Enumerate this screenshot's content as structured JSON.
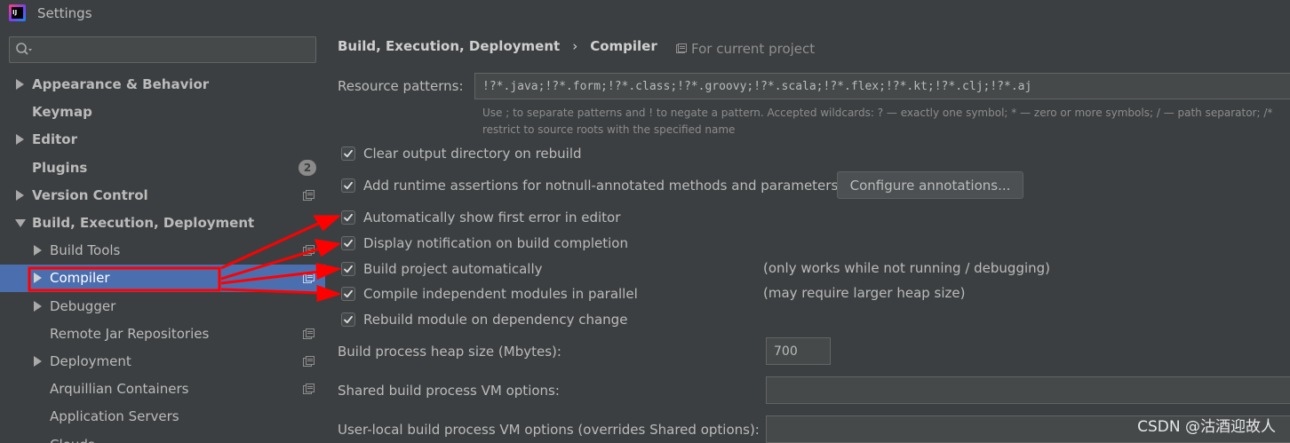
{
  "window": {
    "title": "Settings",
    "logo_text": "IJ"
  },
  "sidebar": {
    "search": {
      "value": "",
      "placeholder": ""
    },
    "items": [
      {
        "label": "Appearance & Behavior",
        "bold": true,
        "expander": "right",
        "level": 0
      },
      {
        "label": "Keymap",
        "bold": true,
        "expander": "none",
        "level": 0
      },
      {
        "label": "Editor",
        "bold": true,
        "expander": "right",
        "level": 0
      },
      {
        "label": "Plugins",
        "bold": true,
        "expander": "none",
        "level": 0,
        "badge": "2"
      },
      {
        "label": "Version Control",
        "bold": true,
        "expander": "right",
        "level": 0,
        "project_icon": true
      },
      {
        "label": "Build, Execution, Deployment",
        "bold": true,
        "expander": "down",
        "level": 0
      },
      {
        "label": "Build Tools",
        "bold": false,
        "expander": "right",
        "level": 1,
        "project_icon": true
      },
      {
        "label": "Compiler",
        "bold": false,
        "expander": "right",
        "level": 1,
        "project_icon": true,
        "selected": true
      },
      {
        "label": "Debugger",
        "bold": false,
        "expander": "right",
        "level": 1
      },
      {
        "label": "Remote Jar Repositories",
        "bold": false,
        "expander": "none",
        "level": 1,
        "project_icon": true
      },
      {
        "label": "Deployment",
        "bold": false,
        "expander": "right",
        "level": 1,
        "project_icon": true
      },
      {
        "label": "Arquillian Containers",
        "bold": false,
        "expander": "none",
        "level": 1,
        "project_icon": true
      },
      {
        "label": "Application Servers",
        "bold": false,
        "expander": "none",
        "level": 1
      },
      {
        "label": "Clouds",
        "bold": false,
        "expander": "none",
        "level": 1
      }
    ]
  },
  "main": {
    "breadcrumb": {
      "parent": "Build, Execution, Deployment",
      "separator": "›",
      "current": "Compiler"
    },
    "scope": "For current project",
    "resource_patterns": {
      "label": "Resource patterns:",
      "value": "!?*.java;!?*.form;!?*.class;!?*.groovy;!?*.scala;!?*.flex;!?*.kt;!?*.clj;!?*.aj",
      "hint_line1": "Use ; to separate patterns and ! to negate a pattern. Accepted wildcards: ? — exactly one symbol; * — zero or more symbols; / — path separator; /*",
      "hint_line2": "restrict to source roots with the specified name"
    },
    "options": [
      {
        "label": "Clear output directory on rebuild",
        "checked": true,
        "note": ""
      },
      {
        "label": "Add runtime assertions for notnull-annotated methods and parameters",
        "checked": true,
        "note": ""
      },
      {
        "label": "Automatically show first error in editor",
        "checked": true,
        "note": ""
      },
      {
        "label": "Display notification on build completion",
        "checked": true,
        "note": ""
      },
      {
        "label": "Build project automatically",
        "checked": true,
        "note": "(only works while not running / debugging)"
      },
      {
        "label": "Compile independent modules in parallel",
        "checked": true,
        "note": "(may require larger heap size)"
      },
      {
        "label": "Rebuild module on dependency change",
        "checked": true,
        "note": ""
      }
    ],
    "configure_button": "Configure annotations...",
    "heap_size": {
      "label": "Build process heap size (Mbytes):",
      "value": "700"
    },
    "shared_vm": {
      "label": "Shared build process VM options:",
      "value": ""
    },
    "user_vm": {
      "label": "User-local build process VM options (overrides Shared options):",
      "value": ""
    }
  },
  "watermark": "CSDN @沽酒迎故人",
  "colors": {
    "background": "#3c3f41",
    "selection": "#4b6eaf",
    "annotation": "#ff0000"
  }
}
